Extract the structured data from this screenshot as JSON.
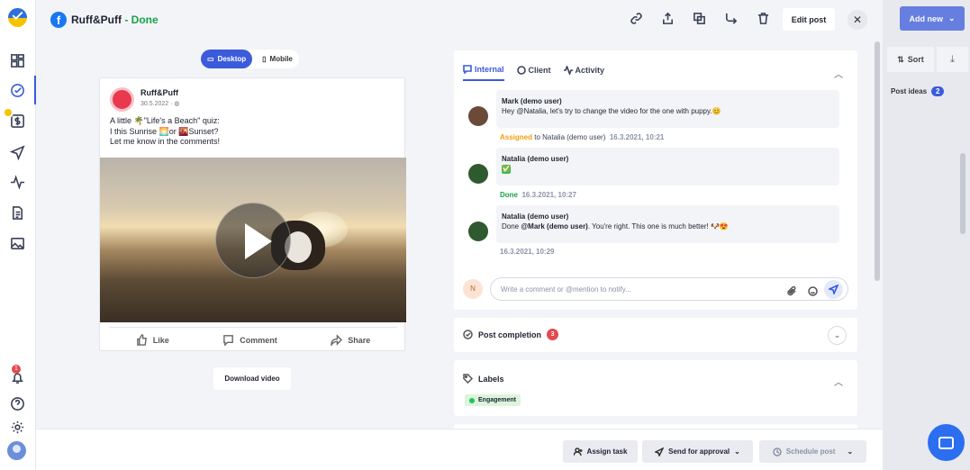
{
  "header": {
    "brand": "Ruff&Puff",
    "separator": " - ",
    "status": "Done",
    "edit_label": "Edit post",
    "icons": [
      "link-icon",
      "share-icon",
      "duplicate-icon",
      "forward-icon",
      "trash-icon",
      "close-icon"
    ]
  },
  "preview": {
    "toggle": [
      "Desktop",
      "Mobile"
    ],
    "page_name": "Ruff&Puff",
    "date": "30.5.2022 · ",
    "text": [
      "A little 🌴\"Life's a Beach\" quiz:",
      "I this Sunrise 🌅or 🌇Sunset?",
      "Let me know in the comments!"
    ],
    "actions": [
      "Like",
      "Comment",
      "Share"
    ],
    "download_label": "Download video"
  },
  "comments": {
    "tabs": [
      "Internal",
      "Client",
      "Activity"
    ],
    "messages": [
      {
        "author": "Mark (demo user)",
        "text": "Hey @Natalia, let's try to change the video for the one with puppy.😊"
      },
      {
        "author": "Natalia (demo user)",
        "text": "✅"
      },
      {
        "author": "Natalia (demo user)",
        "text_pre": "Done ",
        "mention": "@Mark (demo user)",
        "text_post": ". You're right. This one is much better! 🐶😍"
      }
    ],
    "events": [
      {
        "action": "Assigned",
        "detail": " to Natalia (demo user)",
        "time": "16.3.2021, 10:21"
      },
      {
        "action": "Done",
        "time": "16.3.2021, 10:27"
      },
      {
        "time": "16.3.2021, 10:29"
      }
    ],
    "input_placeholder": "Write a comment or @mention to notify...",
    "user_initial": "N"
  },
  "completion": {
    "label": "Post completion",
    "count": "3"
  },
  "labels": {
    "title": "Labels",
    "items": [
      "Engagement"
    ]
  },
  "footer": {
    "assign": "Assign task",
    "approval": "Send for approval",
    "schedule": "Schedule post"
  },
  "background": {
    "add_new": "Add new",
    "sort": "Sort",
    "post_ideas": "Post ideas",
    "post_ideas_count": "2"
  },
  "rail": {
    "bell_count": "1"
  },
  "colors": {
    "accent": "#3b5bdb",
    "done": "#16a34a",
    "assigned": "#f59e0b",
    "facebook": "#1877f2"
  }
}
